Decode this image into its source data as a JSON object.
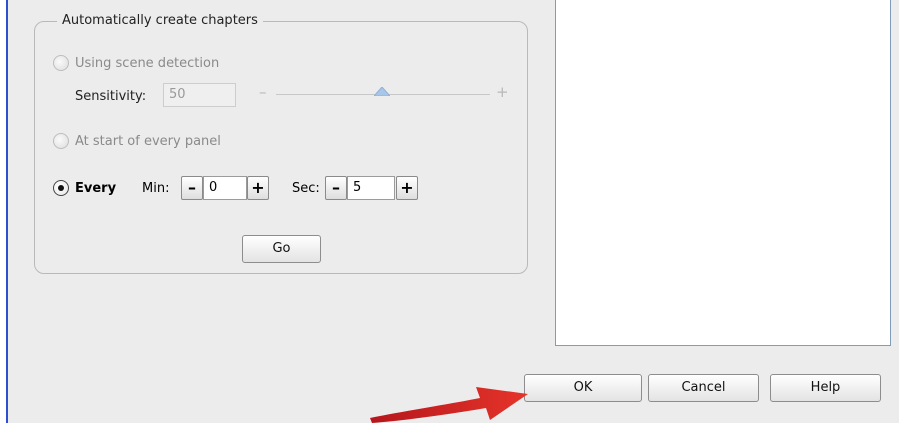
{
  "group": {
    "legend": "Automatically create chapters",
    "scene": {
      "label": "Using scene detection",
      "sensitivity_label": "Sensitivity:",
      "sensitivity_value": "50",
      "slider_minus": "–",
      "slider_plus": "+"
    },
    "panel": {
      "label": "At start of every panel"
    },
    "every": {
      "label": "Every",
      "min_label": "Min:",
      "min_value": "0",
      "sec_label": "Sec:",
      "sec_value": "5",
      "minus": "–",
      "plus": "+"
    },
    "go_label": "Go"
  },
  "footer": {
    "ok": "OK",
    "cancel": "Cancel",
    "help": "Help"
  },
  "colors": {
    "arrow": "#d6261f",
    "window_border": "#2a4fd0",
    "list_border": "#7f9db9"
  }
}
